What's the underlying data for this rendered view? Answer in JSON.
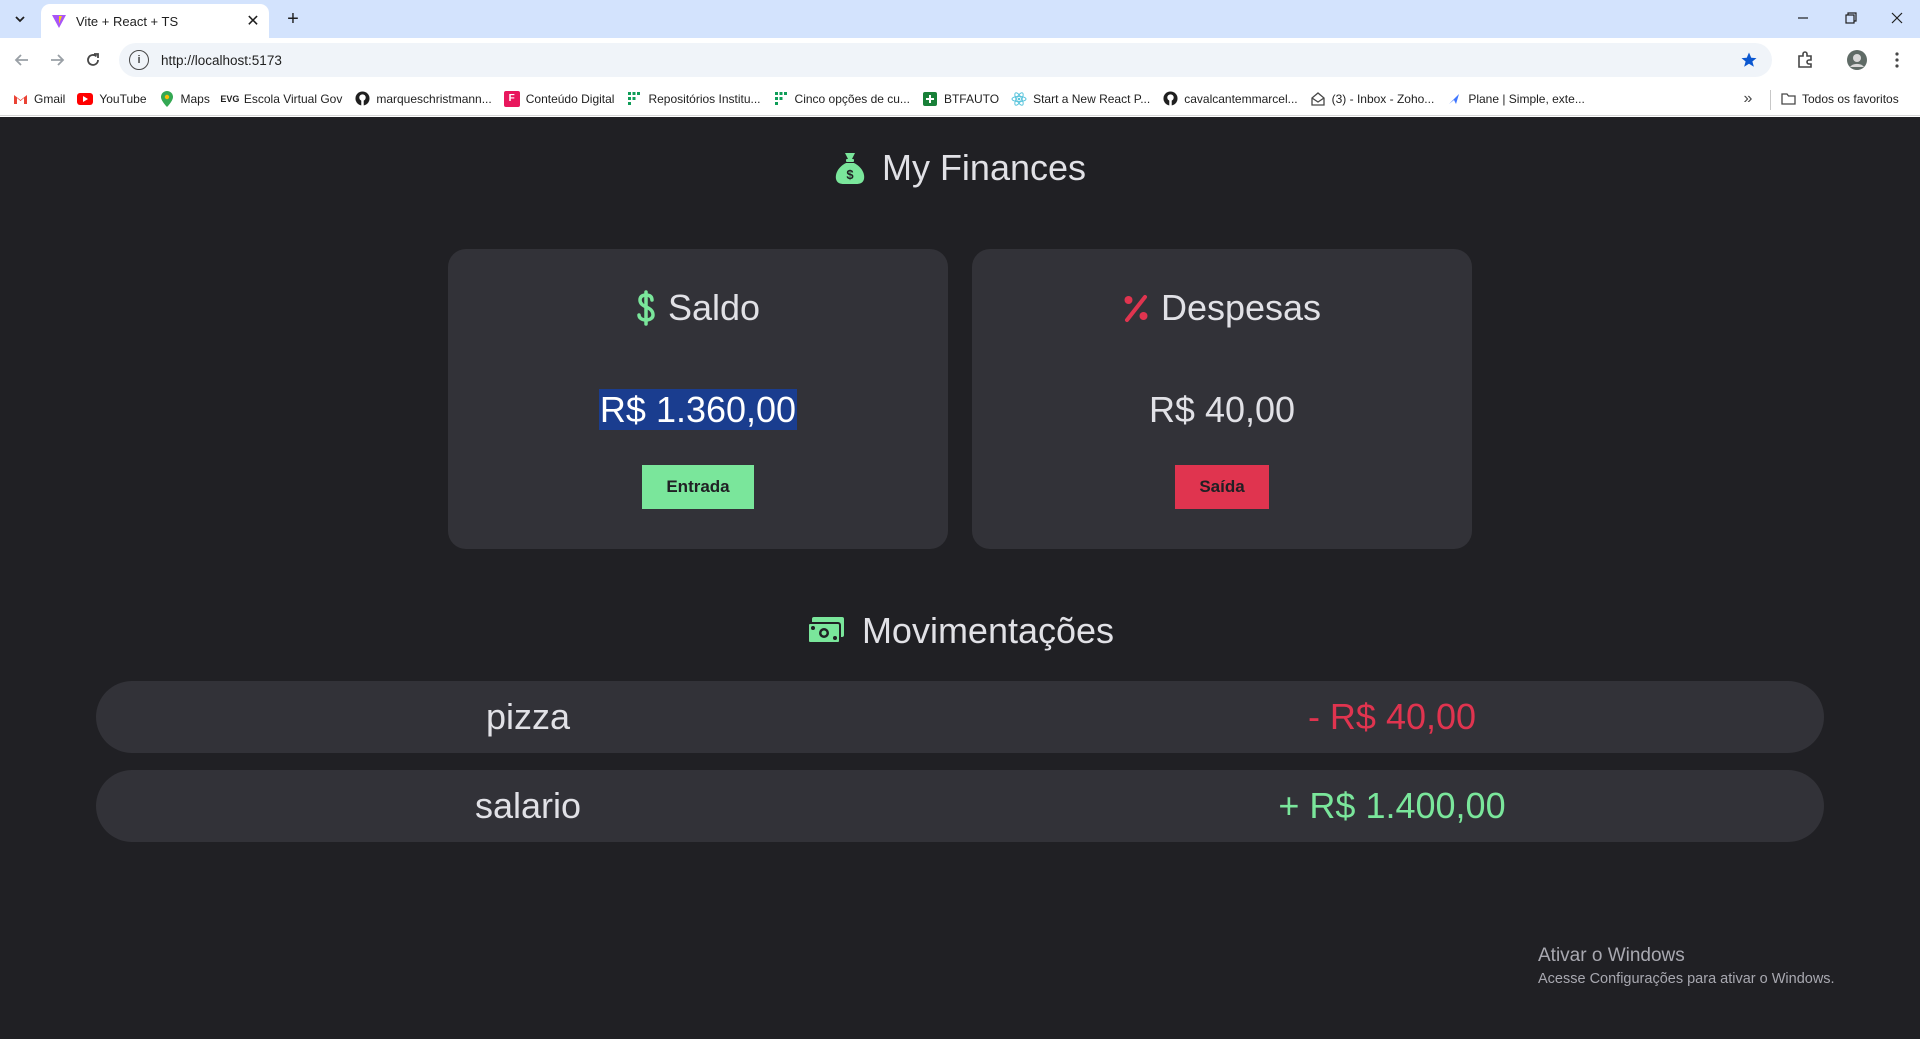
{
  "browser": {
    "tab_title": "Vite + React + TS",
    "url": "http://localhost:5173",
    "bookmarks": [
      {
        "label": "Gmail",
        "icon": "gmail-icon"
      },
      {
        "label": "YouTube",
        "icon": "youtube-icon"
      },
      {
        "label": "Maps",
        "icon": "maps-icon"
      },
      {
        "label": "Escola Virtual Gov",
        "icon": "evg-icon"
      },
      {
        "label": "marqueschristmann...",
        "icon": "github-icon"
      },
      {
        "label": "Conteúdo Digital",
        "icon": "bookmark-f-icon"
      },
      {
        "label": "Repositórios Institu...",
        "icon": "grid-icon"
      },
      {
        "label": "Cinco opções de cu...",
        "icon": "grid-icon"
      },
      {
        "label": "BTFAUTO",
        "icon": "plus-square-icon"
      },
      {
        "label": "Start a New React P...",
        "icon": "react-icon"
      },
      {
        "label": "cavalcantemmarcel...",
        "icon": "github-icon"
      },
      {
        "label": "(3) - Inbox - Zoho...",
        "icon": "mail-icon"
      },
      {
        "label": "Plane | Simple, exte...",
        "icon": "plane-icon"
      }
    ],
    "all_bookmarks_label": "Todos os favoritos"
  },
  "app": {
    "title": "My Finances",
    "balance": {
      "label": "Saldo",
      "value": "R$ 1.360,00",
      "button": "Entrada"
    },
    "expenses": {
      "label": "Despesas",
      "value": "R$ 40,00",
      "button": "Saída"
    },
    "transactions_title": "Movimentações",
    "transactions": [
      {
        "name": "pizza",
        "amount": "- R$ 40,00",
        "type": "expense"
      },
      {
        "name": "salario",
        "amount": "+ R$ 1.400,00",
        "type": "income"
      }
    ]
  },
  "watermark": {
    "title": "Ativar o Windows",
    "subtitle": "Acesse Configurações para ativar o Windows."
  },
  "colors": {
    "background": "#202024",
    "card": "#323238",
    "income": "#7ae69b",
    "expense": "#e0344f",
    "text": "#e1e1e6"
  }
}
